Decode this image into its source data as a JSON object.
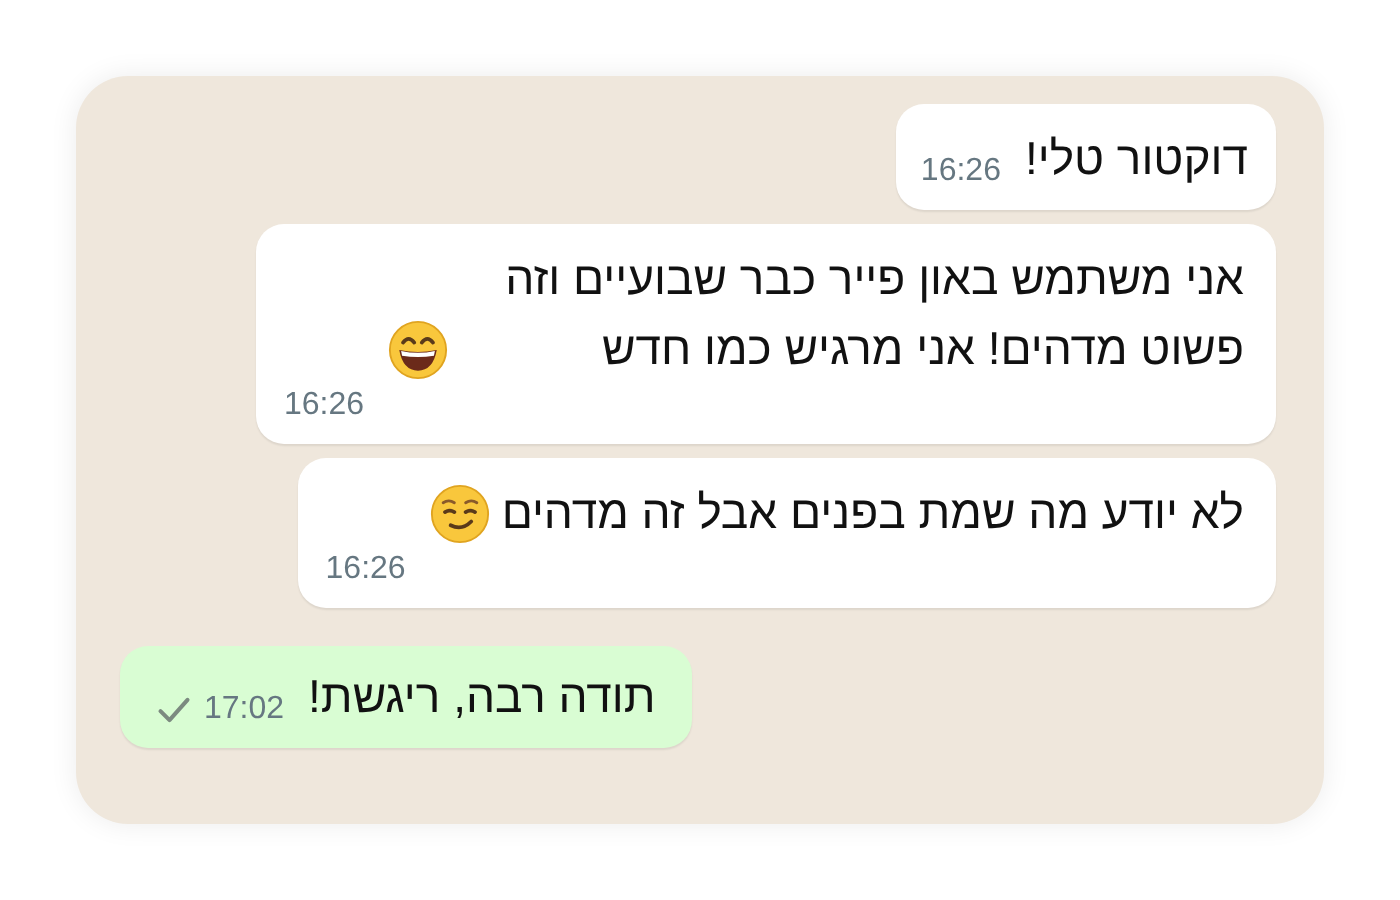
{
  "messages": [
    {
      "kind": "incoming",
      "text": "דוקטור טלי!",
      "time": "16:26"
    },
    {
      "kind": "incoming",
      "text": "אני משתמש באון פייר כבר שבועיים וזה פשוט מדהים! אני מרגיש כמו חדש",
      "emoji": {
        "kind": "grinning"
      },
      "time": "16:26"
    },
    {
      "kind": "incoming",
      "text": "לא יודע מה שמת בפנים אבל זה מדהים",
      "emoji": {
        "kind": "smirking"
      },
      "time": "16:26"
    },
    {
      "kind": "outgoing",
      "text": "תודה רבה, ריגשת!",
      "time": "17:02",
      "tick": {
        "kind": "sent"
      }
    }
  ]
}
